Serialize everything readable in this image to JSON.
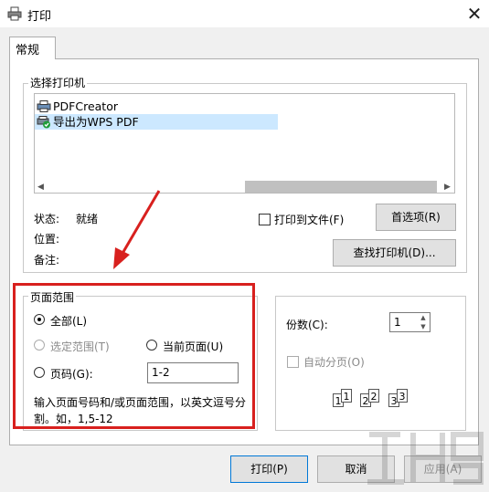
{
  "window": {
    "title": "打印",
    "close_glyph": "✕"
  },
  "tabs": [
    {
      "label": "常规"
    }
  ],
  "select_printer": {
    "group_title": "选择打印机",
    "printers": [
      {
        "label": "PDFCreator"
      },
      {
        "label": "导出为WPS PDF"
      }
    ],
    "status_label": "状态:",
    "status_value": "就绪",
    "location_label": "位置:",
    "comment_label": "备注:",
    "print_to_file_label": "打印到文件(F)",
    "preferences_button": "首选项(R)",
    "find_printer_button": "查找打印机(D)..."
  },
  "page_range": {
    "group_title": "页面范围",
    "all_label": "全部(L)",
    "selection_label": "选定范围(T)",
    "current_page_label": "当前页面(U)",
    "pages_label": "页码(G):",
    "pages_value": "1-2",
    "hint": "输入页面号码和/或页面范围，以英文逗号分割。如，1,5-12"
  },
  "copies": {
    "label": "份数(C):",
    "value": "1",
    "collate_label": "自动分页(O)",
    "collate_pages": [
      "1",
      "1",
      "2",
      "2",
      "3",
      "3"
    ]
  },
  "footer": {
    "print_button": "打印(P)",
    "cancel_button": "取消",
    "apply_button": "应用(A)"
  },
  "icons": {
    "up_arrow": "▲",
    "down_arrow": "▼",
    "left_arrow": "◀",
    "right_arrow": "▶"
  },
  "colors": {
    "selection": "#cce8ff",
    "annotation": "#d8201e"
  }
}
